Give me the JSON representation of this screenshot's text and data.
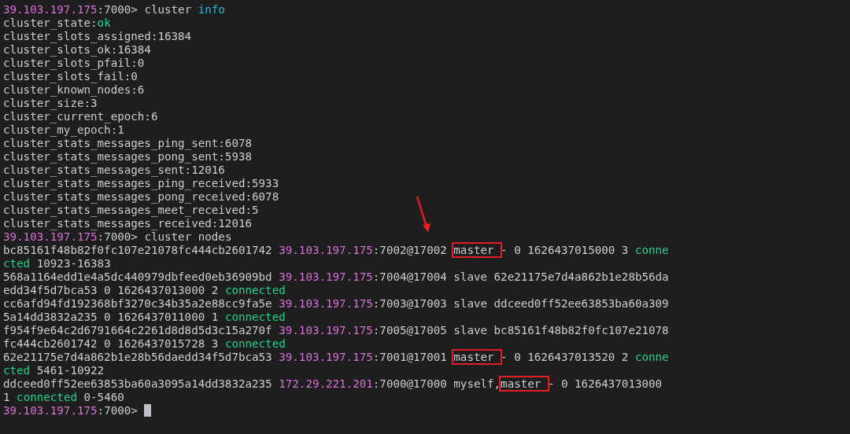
{
  "terminal": {
    "lines": [
      {
        "segments": [
          {
            "text": "39.103.197.175",
            "kind": "host"
          },
          {
            "text": ":7000> cluster ",
            "kind": "plain"
          },
          {
            "text": "info",
            "kind": "keyword"
          }
        ]
      },
      {
        "segments": [
          {
            "text": "cluster_state:",
            "kind": "plain"
          },
          {
            "text": "ok",
            "kind": "good"
          }
        ]
      },
      {
        "segments": [
          {
            "text": "cluster_slots_assigned:16384",
            "kind": "plain"
          }
        ]
      },
      {
        "segments": [
          {
            "text": "cluster_slots_ok:16384",
            "kind": "plain"
          }
        ]
      },
      {
        "segments": [
          {
            "text": "cluster_slots_pfail:0",
            "kind": "plain"
          }
        ]
      },
      {
        "segments": [
          {
            "text": "cluster_slots_fail:0",
            "kind": "plain"
          }
        ]
      },
      {
        "segments": [
          {
            "text": "cluster_known_nodes:6",
            "kind": "plain"
          }
        ]
      },
      {
        "segments": [
          {
            "text": "cluster_size:3",
            "kind": "plain"
          }
        ]
      },
      {
        "segments": [
          {
            "text": "cluster_current_epoch:6",
            "kind": "plain"
          }
        ]
      },
      {
        "segments": [
          {
            "text": "cluster_my_epoch:1",
            "kind": "plain"
          }
        ]
      },
      {
        "segments": [
          {
            "text": "cluster_stats_messages_ping_sent:6078",
            "kind": "plain"
          }
        ]
      },
      {
        "segments": [
          {
            "text": "cluster_stats_messages_pong_sent:5938",
            "kind": "plain"
          }
        ]
      },
      {
        "segments": [
          {
            "text": "cluster_stats_messages_sent:12016",
            "kind": "plain"
          }
        ]
      },
      {
        "segments": [
          {
            "text": "cluster_stats_messages_ping_received:5933",
            "kind": "plain"
          }
        ]
      },
      {
        "segments": [
          {
            "text": "cluster_stats_messages_pong_received:6078",
            "kind": "plain"
          }
        ]
      },
      {
        "segments": [
          {
            "text": "cluster_stats_messages_meet_received:5",
            "kind": "plain"
          }
        ]
      },
      {
        "segments": [
          {
            "text": "cluster_stats_messages_received:12016",
            "kind": "plain"
          }
        ]
      },
      {
        "segments": [
          {
            "text": "39.103.197.175",
            "kind": "host"
          },
          {
            "text": ":7000> cluster nodes",
            "kind": "plain"
          }
        ]
      },
      {
        "segments": [
          {
            "text": "bc85161f48b82f0fc107e21078fc444cb2601742 ",
            "kind": "plain"
          },
          {
            "text": "39.103.197.175",
            "kind": "host"
          },
          {
            "text": ":7002@17002 ",
            "kind": "plain"
          },
          {
            "text": "master ",
            "kind": "boxed"
          },
          {
            "text": "- 0 1626437015000 3 ",
            "kind": "plain"
          },
          {
            "text": "conne",
            "kind": "good"
          }
        ]
      },
      {
        "segments": [
          {
            "text": "cted",
            "kind": "good"
          },
          {
            "text": " 10923-16383",
            "kind": "plain"
          }
        ]
      },
      {
        "segments": [
          {
            "text": "568a1164edd1e4a5dc440979dbfeed0eb36909bd ",
            "kind": "plain"
          },
          {
            "text": "39.103.197.175",
            "kind": "host"
          },
          {
            "text": ":7004@17004 slave 62e21175e7d4a862b1e28b56da",
            "kind": "plain"
          }
        ]
      },
      {
        "segments": [
          {
            "text": "edd34f5d7bca53 0 1626437013000 2 ",
            "kind": "plain"
          },
          {
            "text": "connected",
            "kind": "good"
          }
        ]
      },
      {
        "segments": [
          {
            "text": "cc6afd94fd192368bf3270c34b35a2e88cc9fa5e ",
            "kind": "plain"
          },
          {
            "text": "39.103.197.175",
            "kind": "host"
          },
          {
            "text": ":7003@17003 slave ddceed0ff52ee63853ba60a309",
            "kind": "plain"
          }
        ]
      },
      {
        "segments": [
          {
            "text": "5a14dd3832a235 0 1626437011000 1 ",
            "kind": "plain"
          },
          {
            "text": "connected",
            "kind": "good"
          }
        ]
      },
      {
        "segments": [
          {
            "text": "f954f9e64c2d6791664c2261d8d8d5d3c15a270f ",
            "kind": "plain"
          },
          {
            "text": "39.103.197.175",
            "kind": "host"
          },
          {
            "text": ":7005@17005 slave bc85161f48b82f0fc107e21078",
            "kind": "plain"
          }
        ]
      },
      {
        "segments": [
          {
            "text": "fc444cb2601742 0 1626437015728 3 ",
            "kind": "plain"
          },
          {
            "text": "connected",
            "kind": "good"
          }
        ]
      },
      {
        "segments": [
          {
            "text": "62e21175e7d4a862b1e28b56daedd34f5d7bca53 ",
            "kind": "plain"
          },
          {
            "text": "39.103.197.175",
            "kind": "host"
          },
          {
            "text": ":7001@17001 ",
            "kind": "plain"
          },
          {
            "text": "master ",
            "kind": "boxed"
          },
          {
            "text": "- 0 1626437013520 2 ",
            "kind": "plain"
          },
          {
            "text": "conne",
            "kind": "good"
          }
        ]
      },
      {
        "segments": [
          {
            "text": "cted",
            "kind": "good"
          },
          {
            "text": " 5461-10922",
            "kind": "plain"
          }
        ]
      },
      {
        "segments": [
          {
            "text": "ddceed0ff52ee63853ba60a3095a14dd3832a235 ",
            "kind": "plain"
          },
          {
            "text": "172.29.221.201",
            "kind": "host"
          },
          {
            "text": ":7000@17000 myself,",
            "kind": "plain"
          },
          {
            "text": "master ",
            "kind": "boxed"
          },
          {
            "text": "- 0 1626437013000",
            "kind": "plain"
          }
        ]
      },
      {
        "segments": [
          {
            "text": "1 ",
            "kind": "plain"
          },
          {
            "text": "connected",
            "kind": "good"
          },
          {
            "text": " 0-5460",
            "kind": "plain"
          }
        ]
      },
      {
        "segments": [
          {
            "text": "39.103.197.175",
            "kind": "host"
          },
          {
            "text": ":7000> ",
            "kind": "plain"
          },
          {
            "kind": "cursor"
          }
        ]
      }
    ]
  }
}
